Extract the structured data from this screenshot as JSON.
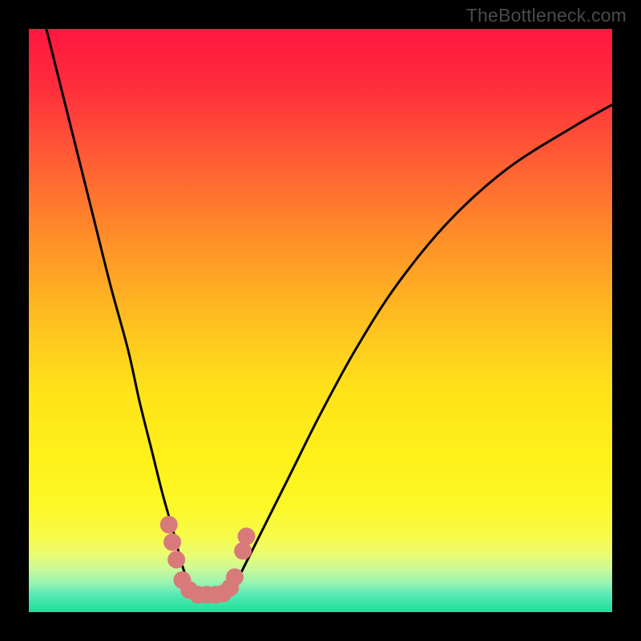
{
  "watermark": "TheBottleneck.com",
  "chart_data": {
    "type": "line",
    "title": "",
    "xlabel": "",
    "ylabel": "",
    "xlim": [
      0,
      100
    ],
    "ylim": [
      0,
      100
    ],
    "series": [
      {
        "name": "v-curve",
        "x": [
          3,
          5,
          8,
          11,
          14,
          17,
          19,
          21,
          23,
          25,
          26,
          27,
          28,
          29,
          30,
          32,
          34,
          35,
          36,
          38,
          41,
          45,
          50,
          56,
          63,
          72,
          82,
          93,
          100
        ],
        "y": [
          100,
          92,
          80,
          68,
          56,
          45,
          36,
          28,
          20,
          13,
          9,
          6,
          4,
          3,
          3,
          3,
          3,
          4,
          6,
          10,
          16,
          24,
          34,
          45,
          56,
          67,
          76,
          83,
          87
        ]
      }
    ],
    "markers": {
      "name": "highlight-dots",
      "color": "#d87a7a",
      "points": [
        {
          "x": 24.0,
          "y": 15
        },
        {
          "x": 24.6,
          "y": 12
        },
        {
          "x": 25.3,
          "y": 9
        },
        {
          "x": 26.3,
          "y": 5.5
        },
        {
          "x": 27.5,
          "y": 3.8
        },
        {
          "x": 29.0,
          "y": 3.0
        },
        {
          "x": 30.5,
          "y": 3.0
        },
        {
          "x": 32.0,
          "y": 3.0
        },
        {
          "x": 33.3,
          "y": 3.2
        },
        {
          "x": 34.5,
          "y": 4.2
        },
        {
          "x": 35.3,
          "y": 6.0
        },
        {
          "x": 36.7,
          "y": 10.5
        },
        {
          "x": 37.3,
          "y": 13.0
        }
      ]
    },
    "background_gradient": {
      "top": "#ff163f",
      "mid": "#ffe31a",
      "bottom": "#1bdf96"
    }
  }
}
